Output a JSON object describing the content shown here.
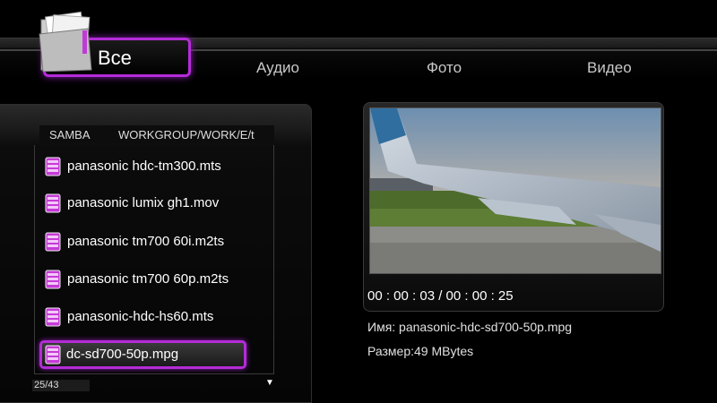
{
  "tabs": {
    "active": "Все",
    "items": [
      "Аудио",
      "Фото",
      "Видео"
    ]
  },
  "browser": {
    "source": "SAMBA",
    "path": "WORKGROUP/WORK/E/t",
    "files": [
      "panasonic hdc-tm300.mts",
      "panasonic lumix gh1.mov",
      "panasonic tm700 60i.m2ts",
      "panasonic tm700 60p.m2ts",
      "panasonic-hdc-hs60.mts",
      "dc-sd700-50p.mpg"
    ],
    "counter": "25/43",
    "scroll_arrow": "▼"
  },
  "preview": {
    "timecode": "00 : 00 : 03 / 00 : 00 : 25",
    "name": "Имя: panasonic-hdc-sd700-50p.mpg",
    "size": "Размер:49 MBytes"
  },
  "colors": {
    "accent": "#b42cd8",
    "background": "#000000",
    "text": "#ffffff"
  },
  "icons": {
    "folder": "folder-icon",
    "file": "video-file-icon"
  }
}
